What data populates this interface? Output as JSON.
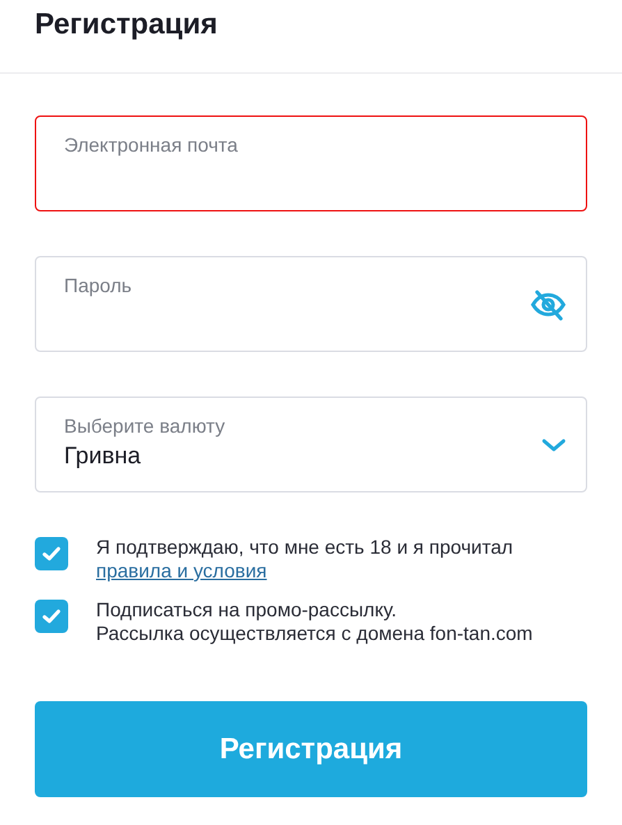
{
  "title": "Регистрация",
  "fields": [
    {
      "kind": "text",
      "label": "Электронная почта",
      "invalid": true
    },
    {
      "kind": "password",
      "label": "Пароль",
      "invalid": false
    },
    {
      "kind": "select",
      "label": "Выберите валюту",
      "value": "Гривна",
      "invalid": false
    }
  ],
  "checkboxes": [
    {
      "lines": [
        "Я подтверждаю, что мне есть 18 и я прочитал"
      ],
      "link": "правила и условия",
      "checked": true
    },
    {
      "lines": [
        "Подписаться на промо-рассылку.",
        "Рассылка осуществляется с домена fon-tan.com"
      ],
      "checked": true
    }
  ],
  "button": "Регистрация"
}
